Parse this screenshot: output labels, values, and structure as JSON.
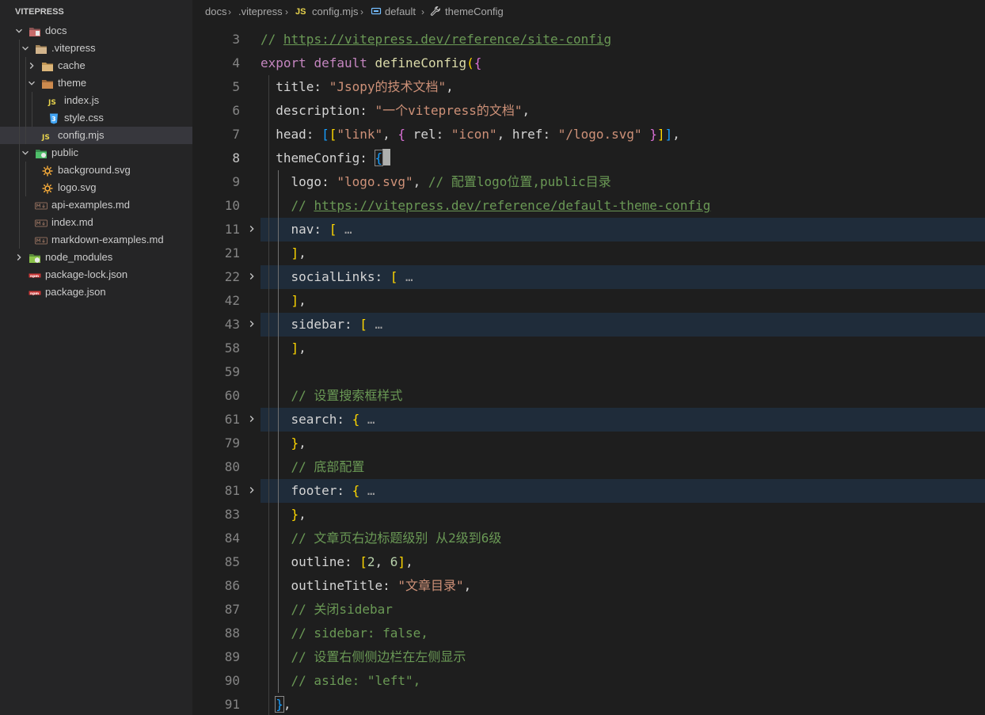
{
  "explorer": {
    "title": "VITEPRESS",
    "items": [
      {
        "label": "docs",
        "depth": 0,
        "twistie": "open",
        "icon": "folder-docs-icon"
      },
      {
        "label": ".vitepress",
        "depth": 1,
        "twistie": "open",
        "icon": "folder-vitepress-icon"
      },
      {
        "label": "cache",
        "depth": 2,
        "twistie": "closed",
        "icon": "folder-icon"
      },
      {
        "label": "theme",
        "depth": 2,
        "twistie": "open",
        "icon": "folder-theme-icon"
      },
      {
        "label": "index.js",
        "depth": 3,
        "twistie": "none",
        "icon": "js-file-icon"
      },
      {
        "label": "style.css",
        "depth": 3,
        "twistie": "none",
        "icon": "css-file-icon"
      },
      {
        "label": "config.mjs",
        "depth": 2,
        "twistie": "none",
        "icon": "js-file-icon",
        "selected": true
      },
      {
        "label": "public",
        "depth": 1,
        "twistie": "open",
        "icon": "folder-public-icon"
      },
      {
        "label": "background.svg",
        "depth": 2,
        "twistie": "none",
        "icon": "svg-file-icon"
      },
      {
        "label": "logo.svg",
        "depth": 2,
        "twistie": "none",
        "icon": "svg-file-icon"
      },
      {
        "label": "api-examples.md",
        "depth": 1,
        "twistie": "none",
        "icon": "markdown-file-icon"
      },
      {
        "label": "index.md",
        "depth": 1,
        "twistie": "none",
        "icon": "markdown-file-icon"
      },
      {
        "label": "markdown-examples.md",
        "depth": 1,
        "twistie": "none",
        "icon": "markdown-file-icon"
      },
      {
        "label": "node_modules",
        "depth": 0,
        "twistie": "closed",
        "icon": "folder-node-icon"
      },
      {
        "label": "package-lock.json",
        "depth": 0,
        "twistie": "none",
        "icon": "npm-file-icon"
      },
      {
        "label": "package.json",
        "depth": 0,
        "twistie": "none",
        "icon": "npm-file-icon"
      }
    ]
  },
  "breadcrumb": {
    "docs": "docs",
    "vitepress": ".vitepress",
    "file_icon": "JS",
    "file": "config.mjs",
    "symbol1": "default",
    "symbol2": "themeConfig"
  },
  "editor": {
    "active_line": "8",
    "lines": [
      {
        "num": "3",
        "fold": "",
        "folded": false,
        "tokens": [
          {
            "t": "// ",
            "c": "comment"
          },
          {
            "t": "https://vitepress.dev/reference/site-config",
            "c": "link"
          }
        ]
      },
      {
        "num": "4",
        "fold": "",
        "folded": false,
        "tokens": [
          {
            "t": "export",
            "c": "kw"
          },
          {
            "t": " ",
            "c": "prop"
          },
          {
            "t": "default",
            "c": "kw"
          },
          {
            "t": " ",
            "c": "prop"
          },
          {
            "t": "defineConfig",
            "c": "fn"
          },
          {
            "t": "(",
            "c": "b1"
          },
          {
            "t": "{",
            "c": "b2"
          }
        ]
      },
      {
        "num": "5",
        "fold": "",
        "folded": false,
        "tokens": [
          {
            "t": "  title: ",
            "c": "prop"
          },
          {
            "t": "\"Jsopy的技术文档\"",
            "c": "str"
          },
          {
            "t": ",",
            "c": "prop"
          }
        ]
      },
      {
        "num": "6",
        "fold": "",
        "folded": false,
        "tokens": [
          {
            "t": "  description: ",
            "c": "prop"
          },
          {
            "t": "\"一个vitepress的文档\"",
            "c": "str"
          },
          {
            "t": ",",
            "c": "prop"
          }
        ]
      },
      {
        "num": "7",
        "fold": "",
        "folded": false,
        "tokens": [
          {
            "t": "  head: ",
            "c": "prop"
          },
          {
            "t": "[",
            "c": "b3"
          },
          {
            "t": "[",
            "c": "b1"
          },
          {
            "t": "\"link\"",
            "c": "str"
          },
          {
            "t": ", ",
            "c": "prop"
          },
          {
            "t": "{",
            "c": "b2"
          },
          {
            "t": " rel: ",
            "c": "prop"
          },
          {
            "t": "\"icon\"",
            "c": "str"
          },
          {
            "t": ", href: ",
            "c": "prop"
          },
          {
            "t": "\"/logo.svg\"",
            "c": "str"
          },
          {
            "t": " ",
            "c": "prop"
          },
          {
            "t": "}",
            "c": "b2"
          },
          {
            "t": "]",
            "c": "b1"
          },
          {
            "t": "]",
            "c": "b3"
          },
          {
            "t": ",",
            "c": "prop"
          }
        ]
      },
      {
        "num": "8",
        "fold": "",
        "folded": false,
        "tokens": [
          {
            "t": "  themeConfig: ",
            "c": "prop"
          },
          {
            "t": "{",
            "c": "b3 bracket-match"
          },
          {
            "t": "",
            "c": "cursor"
          }
        ]
      },
      {
        "num": "9",
        "fold": "",
        "folded": false,
        "tokens": [
          {
            "t": "    logo: ",
            "c": "prop"
          },
          {
            "t": "\"logo.svg\"",
            "c": "str"
          },
          {
            "t": ", ",
            "c": "prop"
          },
          {
            "t": "// 配置logo位置,public目录",
            "c": "comment"
          }
        ]
      },
      {
        "num": "10",
        "fold": "",
        "folded": false,
        "tokens": [
          {
            "t": "    // ",
            "c": "comment"
          },
          {
            "t": "https://vitepress.dev/reference/default-theme-config",
            "c": "link"
          }
        ]
      },
      {
        "num": "11",
        "fold": ">",
        "folded": true,
        "tokens": [
          {
            "t": "    nav: ",
            "c": "prop"
          },
          {
            "t": "[",
            "c": "b1"
          },
          {
            "t": " …",
            "c": "ell"
          }
        ]
      },
      {
        "num": "21",
        "fold": "",
        "folded": false,
        "tokens": [
          {
            "t": "    ",
            "c": "prop"
          },
          {
            "t": "]",
            "c": "b1"
          },
          {
            "t": ",",
            "c": "prop"
          }
        ]
      },
      {
        "num": "22",
        "fold": ">",
        "folded": true,
        "tokens": [
          {
            "t": "    socialLinks: ",
            "c": "prop"
          },
          {
            "t": "[",
            "c": "b1"
          },
          {
            "t": " …",
            "c": "ell"
          }
        ]
      },
      {
        "num": "42",
        "fold": "",
        "folded": false,
        "tokens": [
          {
            "t": "    ",
            "c": "prop"
          },
          {
            "t": "]",
            "c": "b1"
          },
          {
            "t": ",",
            "c": "prop"
          }
        ]
      },
      {
        "num": "43",
        "fold": ">",
        "folded": true,
        "tokens": [
          {
            "t": "    sidebar: ",
            "c": "prop"
          },
          {
            "t": "[",
            "c": "b1"
          },
          {
            "t": " …",
            "c": "ell"
          }
        ]
      },
      {
        "num": "58",
        "fold": "",
        "folded": false,
        "tokens": [
          {
            "t": "    ",
            "c": "prop"
          },
          {
            "t": "]",
            "c": "b1"
          },
          {
            "t": ",",
            "c": "prop"
          }
        ]
      },
      {
        "num": "59",
        "fold": "",
        "folded": false,
        "tokens": []
      },
      {
        "num": "60",
        "fold": "",
        "folded": false,
        "tokens": [
          {
            "t": "    // 设置搜索框样式",
            "c": "comment"
          }
        ]
      },
      {
        "num": "61",
        "fold": ">",
        "folded": true,
        "tokens": [
          {
            "t": "    search: ",
            "c": "prop"
          },
          {
            "t": "{",
            "c": "b1"
          },
          {
            "t": " …",
            "c": "ell"
          }
        ]
      },
      {
        "num": "79",
        "fold": "",
        "folded": false,
        "tokens": [
          {
            "t": "    ",
            "c": "prop"
          },
          {
            "t": "}",
            "c": "b1"
          },
          {
            "t": ",",
            "c": "prop"
          }
        ]
      },
      {
        "num": "80",
        "fold": "",
        "folded": false,
        "tokens": [
          {
            "t": "    // 底部配置",
            "c": "comment"
          }
        ]
      },
      {
        "num": "81",
        "fold": ">",
        "folded": true,
        "tokens": [
          {
            "t": "    footer: ",
            "c": "prop"
          },
          {
            "t": "{",
            "c": "b1"
          },
          {
            "t": " …",
            "c": "ell"
          }
        ]
      },
      {
        "num": "83",
        "fold": "",
        "folded": false,
        "tokens": [
          {
            "t": "    ",
            "c": "prop"
          },
          {
            "t": "}",
            "c": "b1"
          },
          {
            "t": ",",
            "c": "prop"
          }
        ]
      },
      {
        "num": "84",
        "fold": "",
        "folded": false,
        "tokens": [
          {
            "t": "    // 文章页右边标题级别 从2级到6级",
            "c": "comment"
          }
        ]
      },
      {
        "num": "85",
        "fold": "",
        "folded": false,
        "tokens": [
          {
            "t": "    outline: ",
            "c": "prop"
          },
          {
            "t": "[",
            "c": "b1"
          },
          {
            "t": "2",
            "c": "num"
          },
          {
            "t": ", ",
            "c": "prop"
          },
          {
            "t": "6",
            "c": "num"
          },
          {
            "t": "]",
            "c": "b1"
          },
          {
            "t": ",",
            "c": "prop"
          }
        ]
      },
      {
        "num": "86",
        "fold": "",
        "folded": false,
        "tokens": [
          {
            "t": "    outlineTitle: ",
            "c": "prop"
          },
          {
            "t": "\"文章目录\"",
            "c": "str"
          },
          {
            "t": ",",
            "c": "prop"
          }
        ]
      },
      {
        "num": "87",
        "fold": "",
        "folded": false,
        "tokens": [
          {
            "t": "    // 关闭sidebar",
            "c": "comment"
          }
        ]
      },
      {
        "num": "88",
        "fold": "",
        "folded": false,
        "tokens": [
          {
            "t": "    // sidebar: false,",
            "c": "comment"
          }
        ]
      },
      {
        "num": "89",
        "fold": "",
        "folded": false,
        "tokens": [
          {
            "t": "    // 设置右侧侧边栏在左侧显示",
            "c": "comment"
          }
        ]
      },
      {
        "num": "90",
        "fold": "",
        "folded": false,
        "tokens": [
          {
            "t": "    // aside: \"left\",",
            "c": "comment"
          }
        ]
      },
      {
        "num": "91",
        "fold": "",
        "folded": false,
        "tokens": [
          {
            "t": "  ",
            "c": "prop"
          },
          {
            "t": "}",
            "c": "b3 bracket-match"
          },
          {
            "t": ",",
            "c": "prop"
          }
        ]
      }
    ]
  }
}
